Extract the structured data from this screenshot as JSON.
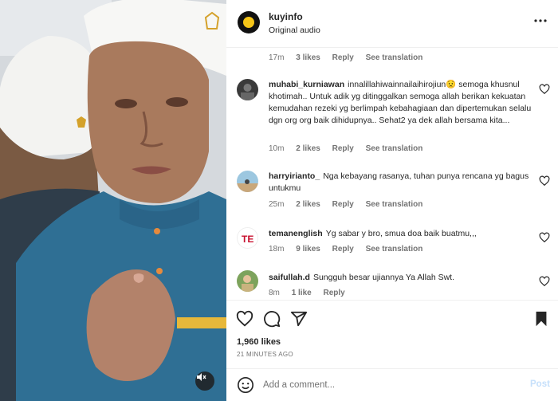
{
  "post": {
    "username": "kuyinfo",
    "audio": "Original audio"
  },
  "top_meta": {
    "time": "17m",
    "likes": "3 likes",
    "reply": "Reply",
    "translate": "See translation"
  },
  "comments": [
    {
      "username": "muhabi_kurniawan",
      "text": "innalillahiwainnailaihirojiun😟 semoga khusnul khotimah.. Untuk adik yg ditinggalkan semoga allah berikan kekuatan kemudahan rezeki yg berlimpah kebahagiaan dan dipertemukan selalu dgn org org baik dihidupnya.. Sehat2 ya dek allah bersama kita...",
      "time": "10m",
      "likes": "2 likes",
      "reply": "Reply",
      "translate": "See translation"
    },
    {
      "username": "harryirianto_",
      "text": "Nga kebayang rasanya, tuhan punya rencana yg bagus untukmu",
      "time": "25m",
      "likes": "2 likes",
      "reply": "Reply",
      "translate": "See translation"
    },
    {
      "username": "temanenglish",
      "text": "Yg sabar y bro, smua doa baik buatmu,,,",
      "time": "18m",
      "likes": "9 likes",
      "reply": "Reply",
      "translate": "See translation"
    },
    {
      "username": "saifullah.d",
      "text": "Sungguh besar ujiannya Ya Allah Swt.",
      "time": "8m",
      "likes": "1 like",
      "reply": "Reply"
    }
  ],
  "footer": {
    "likes": "1,960 likes",
    "ago": "21 MINUTES AGO",
    "placeholder": "Add a comment...",
    "post_label": "Post"
  },
  "colors": {
    "accent_disabled": "#c6e0fb",
    "muted": "#737373",
    "text": "#262626"
  },
  "icons": [
    "more-options-icon",
    "heart-icon",
    "comment-icon",
    "share-icon",
    "bookmark-icon",
    "emoji-icon",
    "mute-icon"
  ]
}
